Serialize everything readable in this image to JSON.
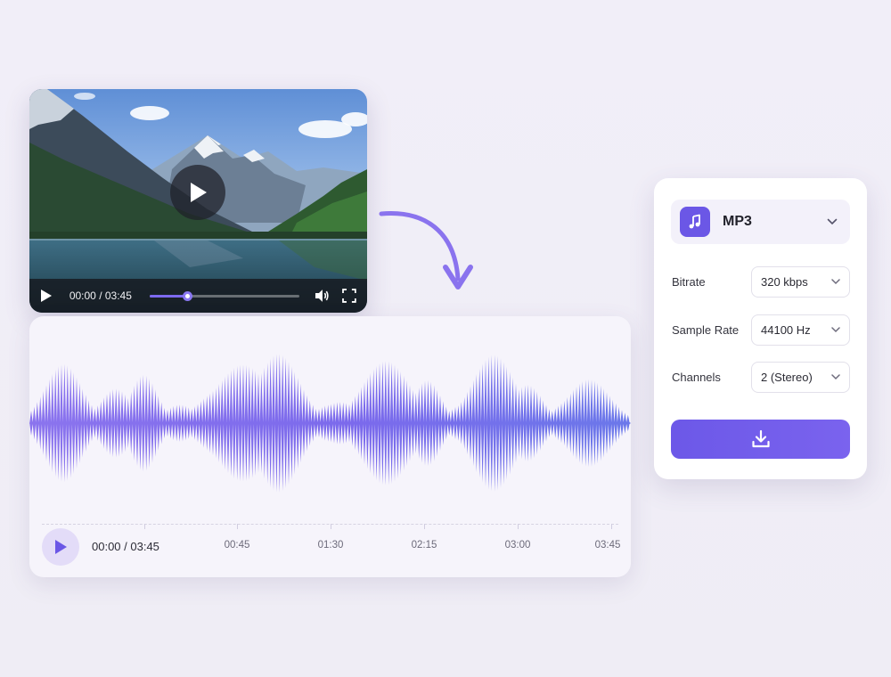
{
  "video_player": {
    "time": "00:00 / 03:45",
    "progress": 0.25,
    "icons": [
      "play-icon",
      "volume-icon",
      "fullscreen-icon"
    ]
  },
  "audio_player": {
    "time": "00:00 / 03:45",
    "timeline_ticks": [
      "00:45",
      "01:30",
      "02:15",
      "03:00",
      "03:45"
    ]
  },
  "export_panel": {
    "format": "MP3",
    "format_icon": "music-note-icon",
    "rows": [
      {
        "label": "Bitrate",
        "value": "320 kbps"
      },
      {
        "label": "Sample Rate",
        "value": "44100 Hz"
      },
      {
        "label": "Channels",
        "value": "2 (Stereo)"
      }
    ],
    "download_icon": "download-icon"
  },
  "colors": {
    "accent": "#6b57e6",
    "waveform_start": "#8b74ee",
    "waveform_end": "#6b78ea",
    "background": "#f1eef8"
  }
}
